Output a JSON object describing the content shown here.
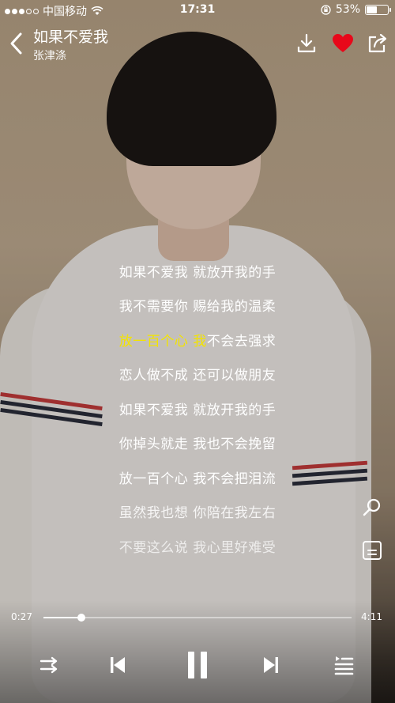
{
  "status_bar": {
    "carrier": "中国移动",
    "time": "17:31",
    "battery_percent": "53%",
    "battery_level": 0.53
  },
  "header": {
    "song_title": "如果不爱我",
    "artist": "张津涤",
    "liked": true,
    "like_color": "#e8081a"
  },
  "lyrics": [
    {
      "before": "如果不爱我 就放开我的手",
      "sung": "",
      "after": ""
    },
    {
      "before": "我不需要你 赐给我的温柔",
      "sung": "",
      "after": ""
    },
    {
      "before": "",
      "sung": "放一百个心 我",
      "after": "不会去强求"
    },
    {
      "before": "恋人做不成 还可以做朋友",
      "sung": "",
      "after": ""
    },
    {
      "before": "如果不爱我 就放开我的手",
      "sung": "",
      "after": ""
    },
    {
      "before": "你掉头就走 我也不会挽留",
      "sung": "",
      "after": ""
    },
    {
      "before": "放一百个心 我不会把泪流",
      "sung": "",
      "after": ""
    },
    {
      "before": "虽然我也想 你陪在我左右",
      "sung": "",
      "after": ""
    },
    {
      "before": "不要这么说 我心里好难受",
      "sung": "",
      "after": ""
    }
  ],
  "lyric_highlight_color": "#f3e400",
  "player": {
    "current_time": "0:27",
    "total_time": "4:11",
    "progress": 0.122
  },
  "icons": {
    "back": "chevron-left-icon",
    "download": "download-icon",
    "like": "heart-icon",
    "share": "share-icon",
    "search_lyrics": "search-icon",
    "lyrics_mode": "lyrics-text-icon",
    "shuffle": "shuffle-icon",
    "previous": "previous-track-icon",
    "pause": "pause-icon",
    "next": "next-track-icon",
    "playlist": "playlist-icon"
  }
}
